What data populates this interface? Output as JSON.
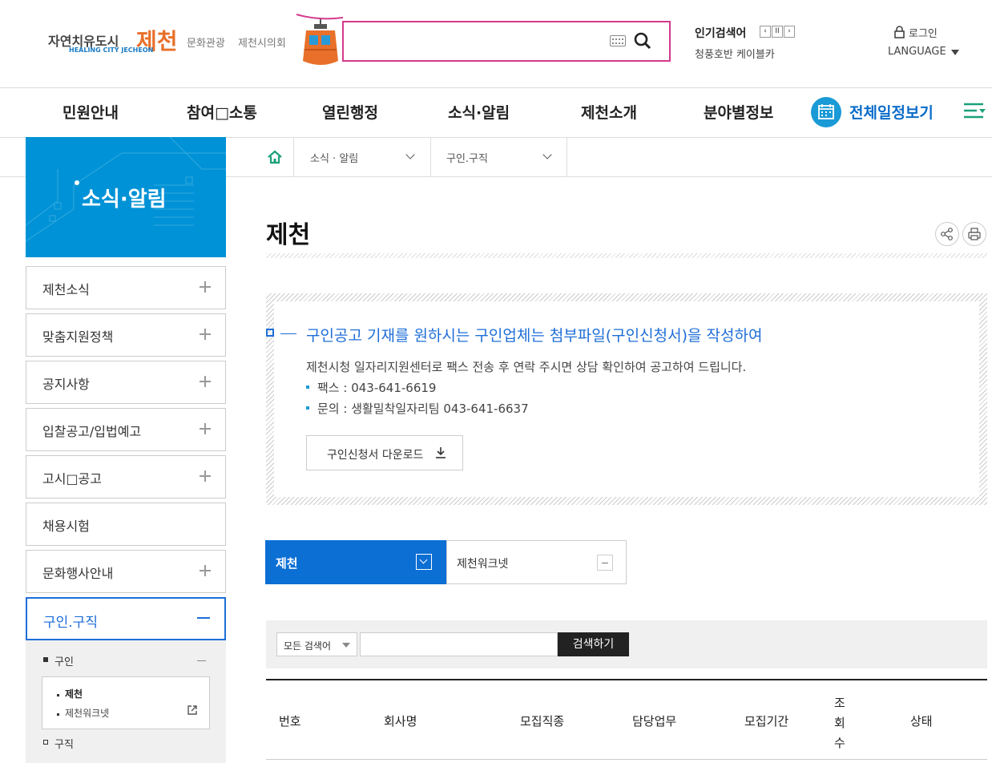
{
  "header": {
    "logo_main": "자연치유도시",
    "logo_city": "제천",
    "logo_en": "HEALING CITY JECHEON",
    "links": [
      "문화관광",
      "제천시의회"
    ],
    "search_placeholder": "",
    "popular_title": "인기검색어",
    "popular_keyword": "청풍호반 케이블카",
    "login": "로그인",
    "language": "LANGUAGE"
  },
  "gnb": {
    "items": [
      "민원안내",
      "참여□소통",
      "열린행정",
      "소식·알림",
      "제천소개",
      "분야별정보"
    ],
    "schedule": "전체일정보기"
  },
  "side": {
    "banner_title": "소식·알림",
    "items": [
      "제천소식",
      "맞춤지원정책",
      "공지사항",
      "입찰공고/입법예고",
      "고시□공고",
      "채용시험",
      "문화행사안내",
      "구인.구직"
    ],
    "sub_item": "구인",
    "sub_sub": [
      "제천",
      "제천워크넷"
    ],
    "sub_item2": "구직"
  },
  "breadcrumb": [
    "소식 · 알림",
    "구인.구직"
  ],
  "page_title": "제천",
  "notice": {
    "heading": "구인공고 기재를 원하시는 구인업체는 첨부파일(구인신청서)을 작성하여",
    "body": "제천시청 일자리지원센터로 팩스 전송 후 연락 주시면 상담 확인하여 공고하여 드립니다.",
    "fax": "팩스 : 043-641-6619",
    "contact": "문의 : 생활밀착일자리팀 043-641-6637",
    "download": "구인신청서 다운로드"
  },
  "tabs": [
    "제천",
    "제천워크넷"
  ],
  "search": {
    "select_value": "모든 검색어",
    "keyword": "",
    "button": "검색하기"
  },
  "table": {
    "headers": [
      "번호",
      "회사명",
      "모집직종",
      "담당업무",
      "모집기간",
      "조회수",
      "상태"
    ]
  }
}
